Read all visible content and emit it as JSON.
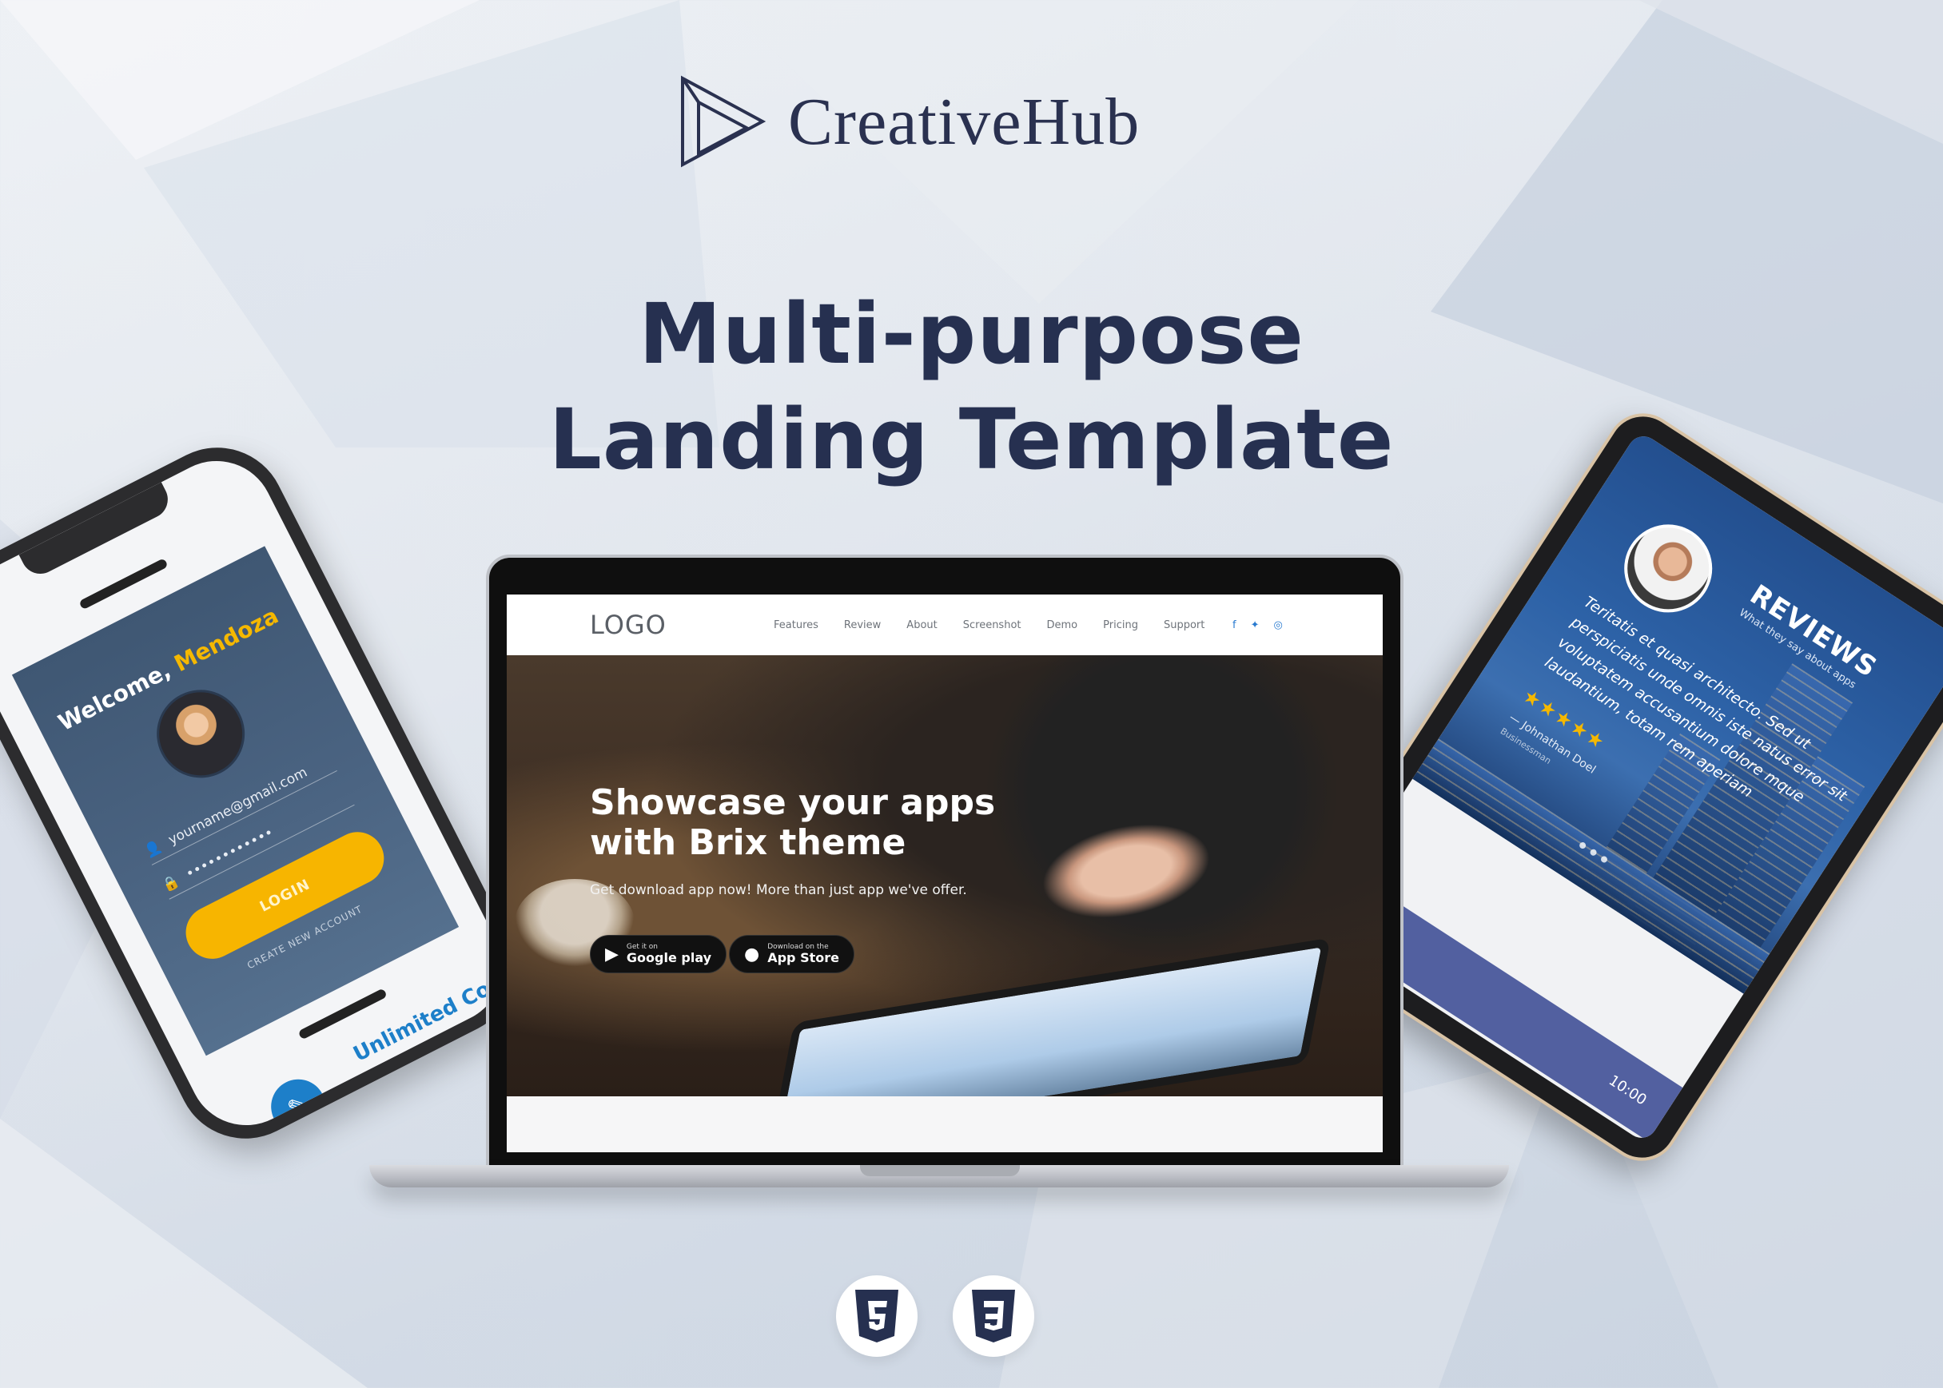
{
  "brand": {
    "name": "CreativeHub",
    "logo_icon": "play-triangle-icon"
  },
  "headline": {
    "line1": "Multi-purpose",
    "line2": "Landing Template"
  },
  "phone": {
    "welcome": "Welcome,",
    "welcome_name": "Mendoza",
    "email_value": "yourname@gmail.com",
    "password_value": "••••••••••••",
    "login_label": "LOGIN",
    "create_account": "CREATE NEW ACCOUNT",
    "feature_label": "Unlimited Colo",
    "fab_icon": "eyedropper-icon"
  },
  "laptop": {
    "logo": "LOGO",
    "menu": [
      "Features",
      "Review",
      "About",
      "Screenshot",
      "Demo",
      "Pricing",
      "Support"
    ],
    "social": [
      "f",
      "t",
      "ig"
    ],
    "hero_title_line1": "Showcase your apps",
    "hero_title_line2": "with Brix theme",
    "hero_sub": "Get download app now! More than just app we've offer.",
    "google_small": "Get it on",
    "google_big": "Google play",
    "apple_small": "Download on the",
    "apple_big": "App Store"
  },
  "tablet": {
    "reviews_title": "REVIEWS",
    "reviews_sub": "What they say about apps",
    "quote": "Teritatis et quasi architecto. Sed ut perspiciatis unde omnis iste natus error sit voluptatem accusantium dolore mque laudantium, totam rem aperiam",
    "stars": "★★★★★",
    "author": "— Johnathan Doel",
    "role": "Businessman",
    "status_time": "10:00"
  },
  "colors": {
    "navy": "#263050",
    "accent_yellow": "#f7b500",
    "accent_blue": "#1d7fc9"
  }
}
